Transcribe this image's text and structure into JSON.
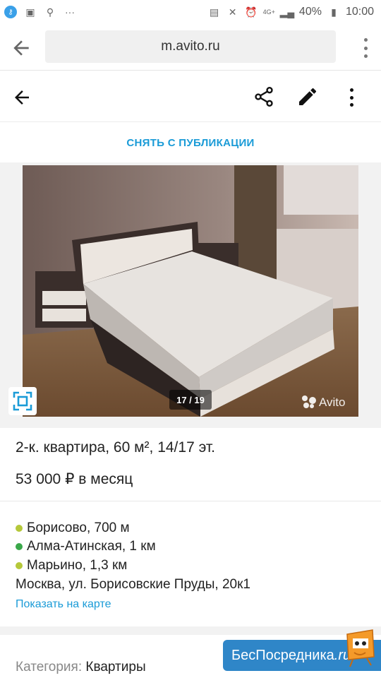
{
  "status_bar": {
    "battery": "40%",
    "time": "10:00",
    "network": "4G+"
  },
  "browser": {
    "url": "m.avito.ru"
  },
  "listing": {
    "unpublish_label": "СНЯТЬ С ПУБЛИКАЦИИ",
    "photo_counter": "17 / 19",
    "watermark": "Avito",
    "title": "2-к. квартира, 60 м², 14/17 эт.",
    "price": "53 000 ₽ в месяц",
    "metro": [
      {
        "name": "Борисово, 700 м",
        "color": "#b5c83a"
      },
      {
        "name": "Алма-Атинская, 1 км",
        "color": "#3aa84a"
      },
      {
        "name": "Марьино, 1,3 км",
        "color": "#b5c83a"
      }
    ],
    "address": "Москва, ул. Борисовские Пруды, 20к1",
    "map_link": "Показать на карте",
    "category_label": "Категория:",
    "category_value": "Квартиры"
  },
  "banner": {
    "text": "БесПосредника",
    "suffix": ".ru"
  },
  "colors": {
    "link": "#1a9bd7",
    "banner": "#2f86c8"
  }
}
